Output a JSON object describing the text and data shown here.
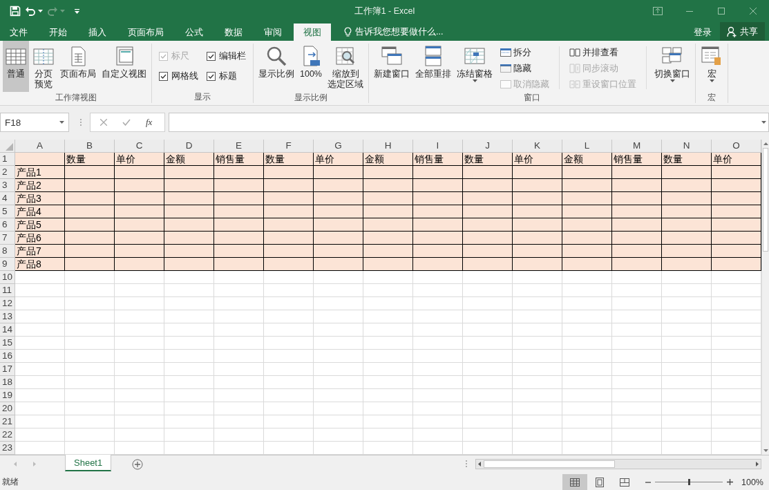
{
  "window": {
    "title": "工作簿1 - Excel"
  },
  "ribbon_tabs": [
    {
      "label": "文件",
      "selected": false
    },
    {
      "label": "开始",
      "selected": false
    },
    {
      "label": "插入",
      "selected": false
    },
    {
      "label": "页面布局",
      "selected": false
    },
    {
      "label": "公式",
      "selected": false
    },
    {
      "label": "数据",
      "selected": false
    },
    {
      "label": "审阅",
      "selected": false
    },
    {
      "label": "视图",
      "selected": true
    }
  ],
  "tell_me": {
    "placeholder": "告诉我您想要做什么..."
  },
  "account": {
    "sign_in": "登录",
    "share": "共享"
  },
  "ribbon": {
    "groups": [
      {
        "label": "工作簿视图",
        "items": [
          {
            "kind": "large",
            "label": "普通",
            "selected": true
          },
          {
            "kind": "large",
            "label": [
              "分页",
              "预览"
            ],
            "selected": false
          },
          {
            "kind": "large",
            "label": "页面布局",
            "selected": false
          },
          {
            "kind": "large",
            "label": "自定义视图",
            "selected": false
          }
        ]
      },
      {
        "label": "显示",
        "items": [
          {
            "kind": "check",
            "label": "标尺",
            "checked": true,
            "disabled": true
          },
          {
            "kind": "check",
            "label": "编辑栏",
            "checked": true,
            "disabled": false
          },
          {
            "kind": "check",
            "label": "网格线",
            "checked": true,
            "disabled": false
          },
          {
            "kind": "check",
            "label": "标题",
            "checked": true,
            "disabled": false
          }
        ]
      },
      {
        "label": "显示比例",
        "items": [
          {
            "kind": "large",
            "label": "显示比例"
          },
          {
            "kind": "large",
            "label": "100%"
          },
          {
            "kind": "large",
            "label": [
              "缩放到",
              "选定区域"
            ]
          }
        ]
      },
      {
        "label": "窗口",
        "items": [
          {
            "kind": "large",
            "label": "新建窗口"
          },
          {
            "kind": "large",
            "label": "全部重排"
          },
          {
            "kind": "large",
            "label": "冻结窗格",
            "dropdown": true
          },
          {
            "kind": "stack",
            "items": [
              {
                "kind": "small",
                "label": "拆分",
                "disabled": false
              },
              {
                "kind": "small",
                "label": "隐藏",
                "disabled": false
              },
              {
                "kind": "small",
                "label": "取消隐藏",
                "disabled": true
              }
            ]
          },
          {
            "kind": "stack",
            "items": [
              {
                "kind": "small",
                "label": "并排查看",
                "disabled": false
              },
              {
                "kind": "small",
                "label": "同步滚动",
                "disabled": true
              },
              {
                "kind": "small",
                "label": "重设窗口位置",
                "disabled": true
              }
            ]
          },
          {
            "kind": "large",
            "label": "切换窗口",
            "dropdown": true
          }
        ]
      },
      {
        "label": "宏",
        "items": [
          {
            "kind": "large",
            "label": "宏",
            "dropdown": true
          }
        ]
      }
    ]
  },
  "formula_bar": {
    "name_box": "F18",
    "function_label": "fx"
  },
  "sheet": {
    "columns": [
      "A",
      "B",
      "C",
      "D",
      "E",
      "F",
      "G",
      "H",
      "I",
      "J",
      "K",
      "L",
      "M",
      "N",
      "O"
    ],
    "rows": [
      {
        "number": "1",
        "highlighted": true,
        "values": [
          "数量",
          "单价",
          "金额",
          "销售量",
          "数量",
          "单价",
          "金额",
          "销售量",
          "数量",
          "单价",
          "金额",
          "销售量",
          "数量",
          "单价"
        ]
      },
      {
        "number": "2",
        "highlighted": true,
        "label": "产品1"
      },
      {
        "number": "3",
        "highlighted": true,
        "label": "产品2"
      },
      {
        "number": "4",
        "highlighted": true,
        "label": "产品3"
      },
      {
        "number": "5",
        "highlighted": true,
        "label": "产品4"
      },
      {
        "number": "6",
        "highlighted": true,
        "label": "产品5"
      },
      {
        "number": "7",
        "highlighted": true,
        "label": "产品6"
      },
      {
        "number": "8",
        "highlighted": true,
        "label": "产品7"
      },
      {
        "number": "9",
        "highlighted": true,
        "label": "产品8"
      },
      {
        "number": "10",
        "highlighted": false
      },
      {
        "number": "11",
        "highlighted": false
      },
      {
        "number": "12",
        "highlighted": false
      },
      {
        "number": "13",
        "highlighted": false
      },
      {
        "number": "14",
        "highlighted": false
      },
      {
        "number": "15",
        "highlighted": false
      },
      {
        "number": "16",
        "highlighted": false
      },
      {
        "number": "17",
        "highlighted": false
      },
      {
        "number": "18",
        "highlighted": false
      },
      {
        "number": "19",
        "highlighted": false
      },
      {
        "number": "20",
        "highlighted": false
      },
      {
        "number": "21",
        "highlighted": false
      },
      {
        "number": "22",
        "highlighted": false
      },
      {
        "number": "23",
        "highlighted": false
      }
    ]
  },
  "sheet_tabs": [
    {
      "label": "Sheet1",
      "selected": true
    }
  ],
  "status_bar": {
    "status": "就绪",
    "view_modes": [
      {
        "kind": "normal",
        "selected": true
      },
      {
        "kind": "page-layout",
        "selected": false
      },
      {
        "kind": "page-break",
        "selected": false
      }
    ],
    "zoom": {
      "level": 0.5,
      "reading": "100%"
    }
  }
}
